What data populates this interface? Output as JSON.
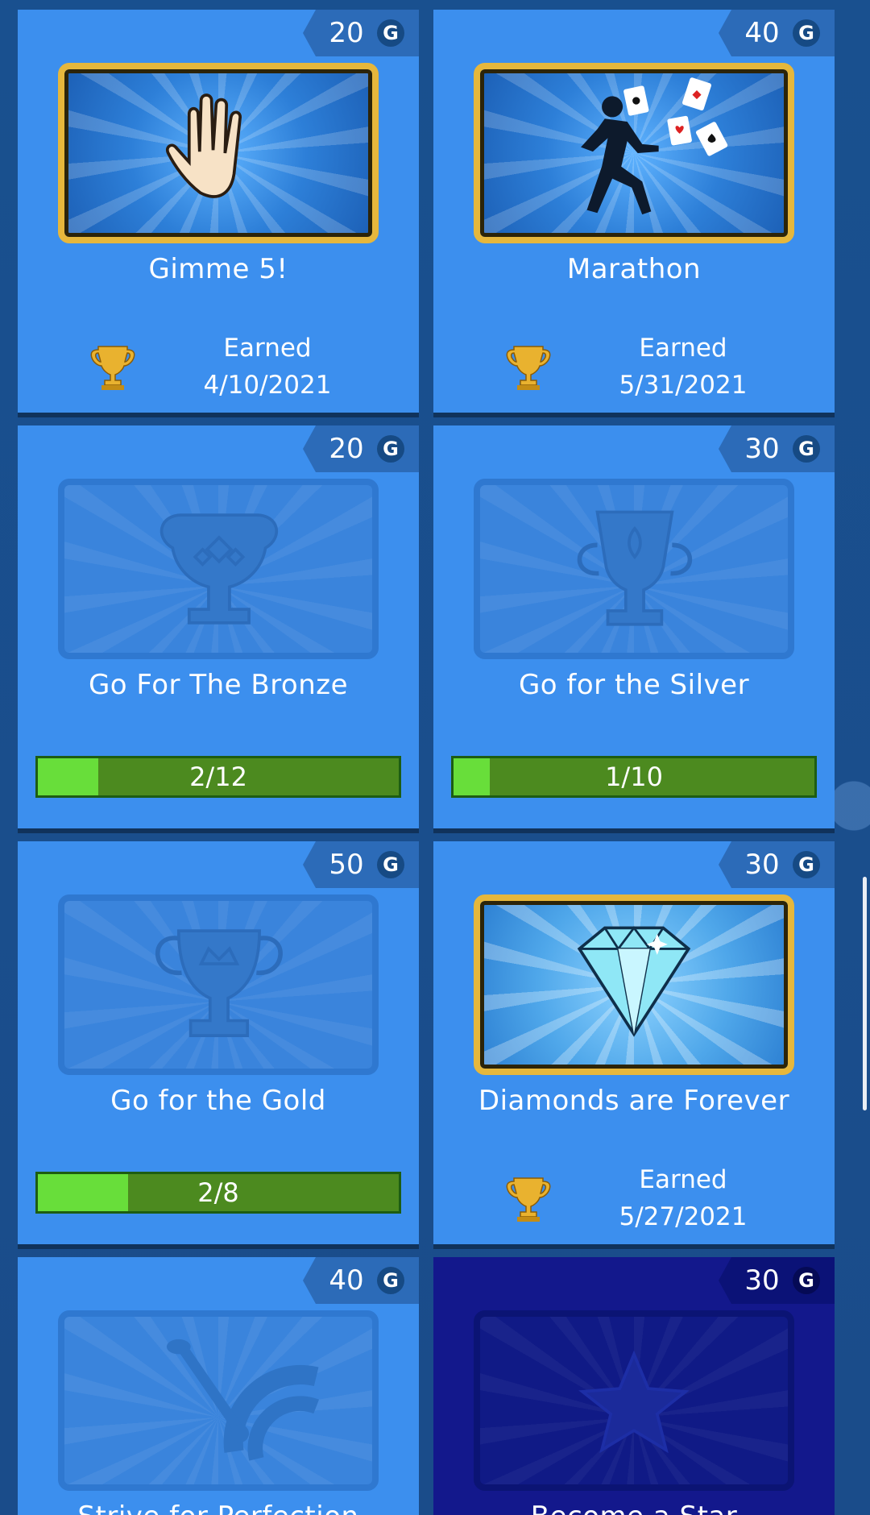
{
  "achievements": [
    {
      "points": "20",
      "currency": "G",
      "title": "Gimme 5!",
      "status": "earned",
      "earned_label": "Earned",
      "earned_date": "4/10/2021",
      "art": "hand-icon"
    },
    {
      "points": "40",
      "currency": "G",
      "title": "Marathon",
      "status": "earned",
      "earned_label": "Earned",
      "earned_date": "5/31/2021",
      "art": "runner-cards-icon"
    },
    {
      "points": "20",
      "currency": "G",
      "title": "Go For The Bronze",
      "status": "progress",
      "progress_text": "2/12",
      "progress": 0.167,
      "art": "bronze-cup-icon"
    },
    {
      "points": "30",
      "currency": "G",
      "title": "Go for the Silver",
      "status": "progress",
      "progress_text": "1/10",
      "progress": 0.1,
      "art": "silver-cup-icon"
    },
    {
      "points": "50",
      "currency": "G",
      "title": "Go for the Gold",
      "status": "progress",
      "progress_text": "2/8",
      "progress": 0.25,
      "art": "gold-cup-icon"
    },
    {
      "points": "30",
      "currency": "G",
      "title": "Diamonds are Forever",
      "status": "earned",
      "earned_label": "Earned",
      "earned_date": "5/27/2021",
      "art": "diamond-icon"
    },
    {
      "points": "40",
      "currency": "G",
      "title": "Strive for Perfection",
      "status": "locked",
      "art": "dart-target-icon"
    },
    {
      "points": "30",
      "currency": "G",
      "title": "Become a Star",
      "status": "locked",
      "art": "star-icon"
    }
  ],
  "colors": {
    "card": "#3c8fee",
    "card_dark": "#13188c",
    "progress_track": "#4c8a1f",
    "progress_fill": "#68de3a",
    "gold_frame": "#e6b73c"
  }
}
